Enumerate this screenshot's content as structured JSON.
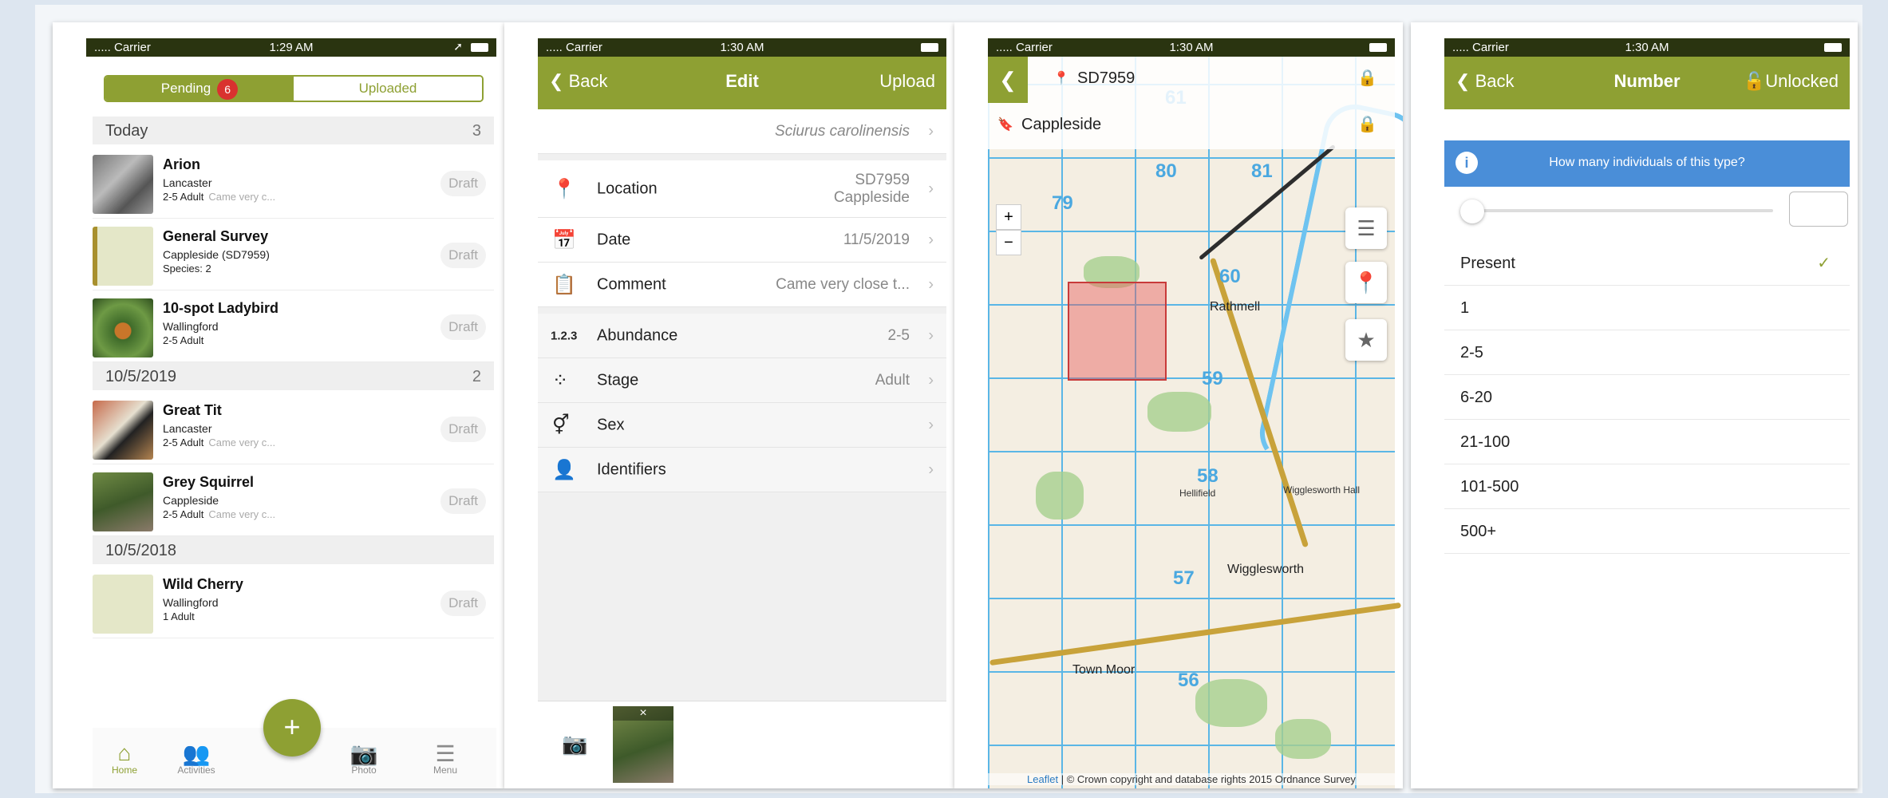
{
  "colors": {
    "accent": "#8ea033",
    "status_bar": "#2a3410",
    "info": "#4a8ed8",
    "badge": "#d9322f"
  },
  "status": {
    "carrier": "..... Carrier",
    "time1": "1:29 AM",
    "time2": "1:30 AM",
    "time3": "1:30 AM",
    "time4": "1:30 AM"
  },
  "list": {
    "seg_pending": "Pending",
    "pending_count": "6",
    "seg_uploaded": "Uploaded",
    "draft_label": "Draft",
    "sections": [
      {
        "label": "Today",
        "count": "3"
      },
      {
        "label": "10/5/2019",
        "count": "2"
      },
      {
        "label": "10/5/2018",
        "count": ""
      }
    ],
    "records": [
      {
        "name": "Arion",
        "location": "Lancaster",
        "meta": "2-5  Adult",
        "comment": "Came very c..."
      },
      {
        "name": "General Survey",
        "location": "Cappleside (SD7959)",
        "meta": "Species: 2",
        "comment": ""
      },
      {
        "name": "10-spot Ladybird",
        "location": "Wallingford",
        "meta": "2-5  Adult",
        "comment": ""
      },
      {
        "name": "Great Tit",
        "location": "Lancaster",
        "meta": "2-5  Adult",
        "comment": "Came very c..."
      },
      {
        "name": "Grey Squirrel",
        "location": "Cappleside",
        "meta": "2-5  Adult",
        "comment": "Came very c..."
      },
      {
        "name": "Wild Cherry",
        "location": "Wallingford",
        "meta": "1  Adult",
        "comment": ""
      }
    ],
    "tabs": {
      "home": "Home",
      "activities": "Activities",
      "photo": "Photo",
      "menu": "Menu",
      "add": "+"
    }
  },
  "edit": {
    "back": "Back",
    "title": "Edit",
    "upload": "Upload",
    "species": "Sciurus carolinensis",
    "rows": [
      {
        "label": "Location",
        "value": "SD7959",
        "value2": "Cappleside",
        "icon": "pin-icon"
      },
      {
        "label": "Date",
        "value": "11/5/2019",
        "icon": "calendar-icon"
      },
      {
        "label": "Comment",
        "value": "Came very close t...",
        "icon": "clipboard-icon"
      },
      {
        "label": "Abundance",
        "value": "2-5",
        "icon": "numbers-icon",
        "icon_text": "1.2.3"
      },
      {
        "label": "Stage",
        "value": "Adult",
        "icon": "stage-icon"
      },
      {
        "label": "Sex",
        "value": "",
        "icon": "gender-icon"
      },
      {
        "label": "Identifiers",
        "value": "",
        "icon": "person-icon"
      }
    ],
    "photo_remove": "×"
  },
  "map": {
    "gridref": "SD7959",
    "place": "Cappleside",
    "grid_numbers": [
      "61",
      "80",
      "81",
      "79",
      "60",
      "59",
      "58",
      "57",
      "56"
    ],
    "towns": [
      "Rathmell",
      "Wigglesworth",
      "Town Moor",
      "Wigglesworth Hall",
      "Hellifield"
    ],
    "attribution_leaflet": "Leaflet",
    "attribution_text": " | © Crown copyright and database rights 2015 Ordnance Survey"
  },
  "number": {
    "back": "Back",
    "title": "Number",
    "unlocked": "Unlocked",
    "info": "How many individuals of this type?",
    "options": [
      "Present",
      "1",
      "2-5",
      "6-20",
      "21-100",
      "101-500",
      "500+"
    ],
    "selected": "Present"
  }
}
